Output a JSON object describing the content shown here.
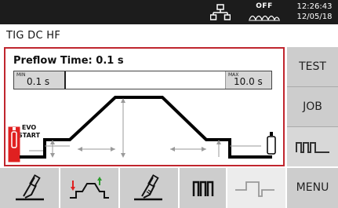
{
  "status": {
    "off_label": "OFF",
    "time": "12:26:43",
    "date": "12/05/18"
  },
  "mode": "TIG DC HF",
  "parameter": {
    "title": "Preflow Time: 0.1 s",
    "min_tag": "MIN",
    "min_value": "0.1 s",
    "max_tag": "MAX",
    "max_value": "10.0 s",
    "level": 0
  },
  "evo_start": [
    "EVO",
    "START"
  ],
  "side_buttons": {
    "test": "TEST",
    "job": "JOB",
    "menu": "MENU"
  },
  "colors": {
    "accent": "#c0262e",
    "button": "#cdcdcd",
    "topbar": "#1c1c1c",
    "gas": "#e02020",
    "ramp_up": "#2a9a2a"
  },
  "icons": [
    "network-icon",
    "wave-icon",
    "torch-icon",
    "pulse-icon",
    "process-icon",
    "torch-settings-icon",
    "pulse-mode-icon",
    "waveform-icon",
    "gas-bottle-icon"
  ]
}
